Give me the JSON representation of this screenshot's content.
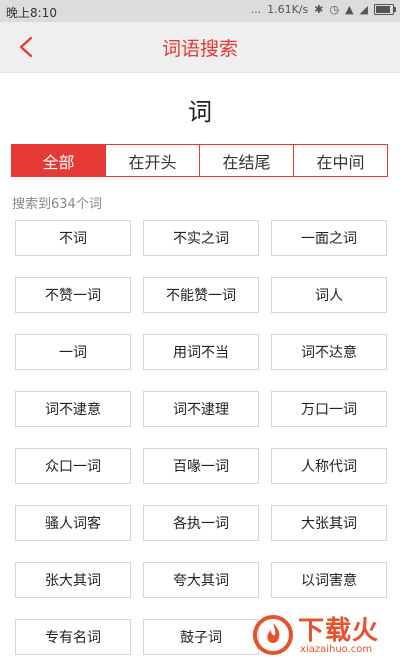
{
  "status_bar": {
    "time": "晚上8:10",
    "network_speed": "1.61K/s",
    "dots": "...",
    "battery_level": 0.85
  },
  "header": {
    "title": "词语搜索"
  },
  "word": "词",
  "tabs": [
    {
      "label": "全部",
      "active": true
    },
    {
      "label": "在开头",
      "active": false
    },
    {
      "label": "在结尾",
      "active": false
    },
    {
      "label": "在中间",
      "active": false
    }
  ],
  "result_count_text": "搜索到634个词",
  "results": [
    "不词",
    "不实之词",
    "一面之词",
    "不赞一词",
    "不能赞一词",
    "词人",
    "一词",
    "用词不当",
    "词不达意",
    "词不逮意",
    "词不逮理",
    "万口一词",
    "众口一词",
    "百喙一词",
    "人称代词",
    "骚人词客",
    "各执一词",
    "大张其词",
    "张大其词",
    "夸大其词",
    "以词害意",
    "专有名词",
    "鼓子词"
  ],
  "watermark": {
    "text": "下载火",
    "url": "xiazaihuo.com"
  },
  "colors": {
    "accent": "#e53935",
    "header_bg": "#efefef",
    "status_bg": "#dcdcdc"
  }
}
